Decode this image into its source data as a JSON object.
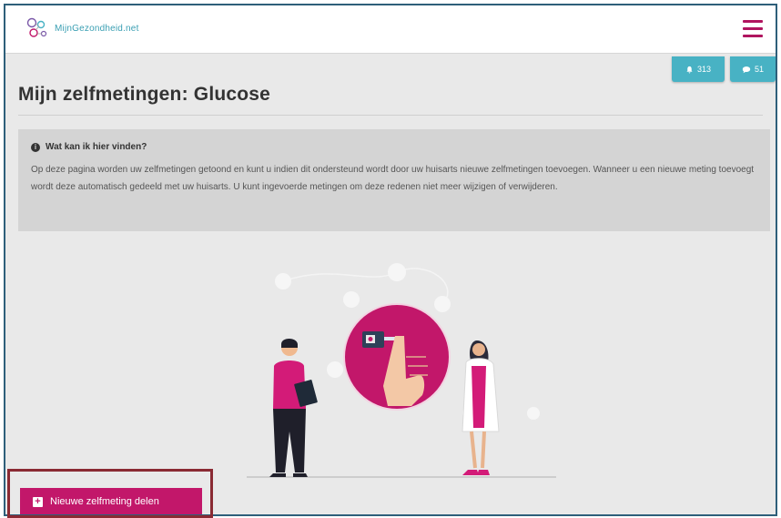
{
  "header": {
    "logo_text": "MijnGezondheid.net",
    "menu_icon": "hamburger-icon"
  },
  "notifications": {
    "bell_icon": "bell-icon",
    "bell_count": "313",
    "chat_icon": "chat-icon",
    "chat_count": "51"
  },
  "page": {
    "title": "Mijn zelfmetingen: Glucose"
  },
  "info": {
    "icon": "info-icon",
    "heading": "Wat kan ik hier vinden?",
    "body": "Op deze pagina worden uw zelfmetingen getoond en kunt u indien dit ondersteund wordt door uw huisarts nieuwe zelfmetingen toevoegen. Wanneer u een nieuwe meting toevoegt wordt deze automatisch gedeeld met uw huisarts. U kunt ingevoerde metingen om deze redenen niet meer wijzigen of verwijderen."
  },
  "actions": {
    "new_measurement_label": "Nieuwe zelfmeting delen",
    "new_measurement_icon": "plus-square-icon"
  },
  "colors": {
    "brand_magenta": "#c2176a",
    "accent_teal": "#48b2c4",
    "highlight_border": "#8a2a33"
  }
}
